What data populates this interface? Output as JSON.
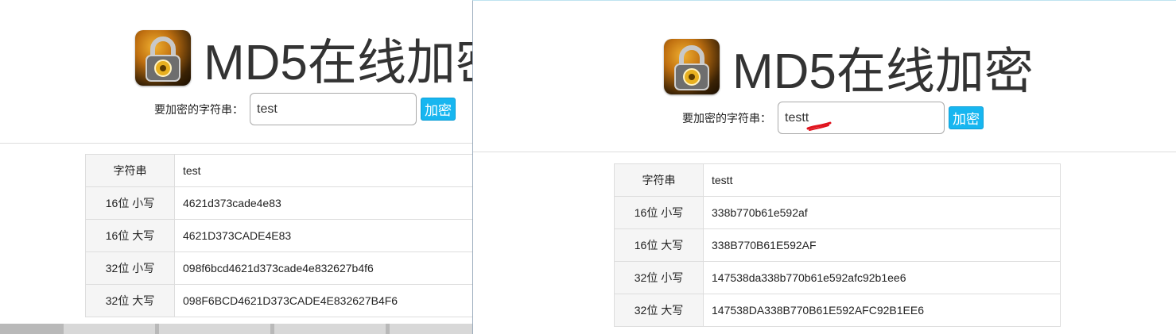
{
  "app": {
    "title": "MD5在线加密"
  },
  "form": {
    "label": "要加密的字符串：",
    "button_label": "加密"
  },
  "row_labels": [
    "字符串",
    "16位 小写",
    "16位 大写",
    "32位 小写",
    "32位 大写"
  ],
  "left_window": {
    "input_value": "test",
    "rows": [
      {
        "label": "字符串",
        "value": "test"
      },
      {
        "label": "16位 小写",
        "value": "4621d373cade4e83"
      },
      {
        "label": "16位 大写",
        "value": "4621D373CADE4E83"
      },
      {
        "label": "32位 小写",
        "value": "098f6bcd4621d373cade4e832627b4f6"
      },
      {
        "label": "32位 大写",
        "value": "098F6BCD4621D373CADE4E832627B4F6"
      }
    ]
  },
  "right_window": {
    "input_value": "testt",
    "rows": [
      {
        "label": "字符串",
        "value": "testt"
      },
      {
        "label": "16位 小写",
        "value": "338b770b61e592af"
      },
      {
        "label": "16位 大写",
        "value": "338B770B61E592AF"
      },
      {
        "label": "32位 小写",
        "value": "147538da338b770b61e592afc92b1ee6"
      },
      {
        "label": "32位 大写",
        "value": "147538DA338B770B61E592AFC92B1EE6"
      }
    ]
  },
  "colors": {
    "button": "#17b6f0",
    "annotation": "#e0141e",
    "border": "#dddddd",
    "label_bg": "#f5f5f5"
  },
  "icons": {
    "logo": "padlock-icon"
  }
}
